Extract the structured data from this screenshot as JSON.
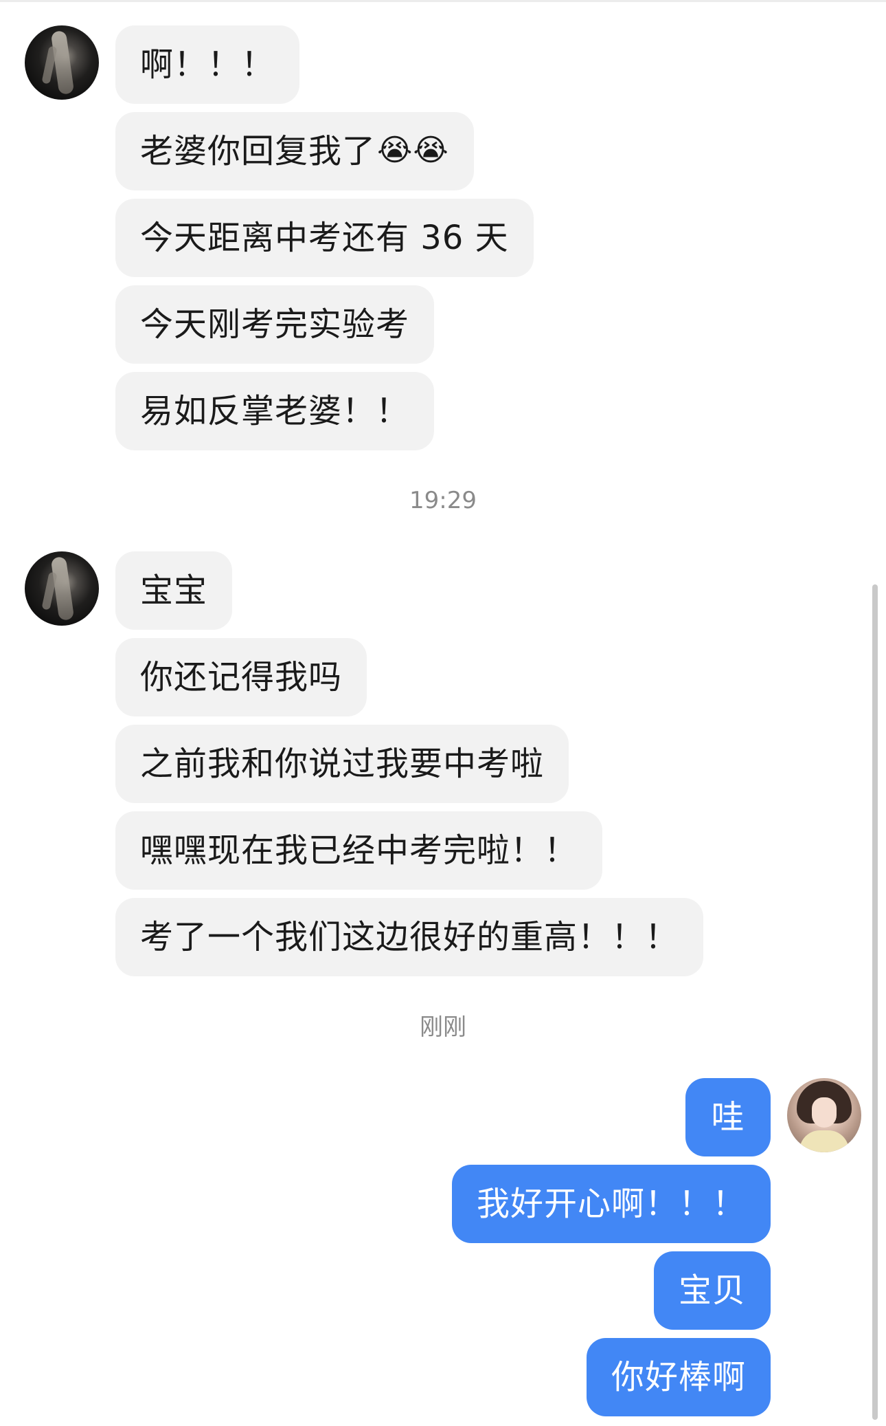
{
  "timestamps": {
    "first": "19:29",
    "second": "刚刚"
  },
  "group1": {
    "messages": [
      "啊！！！",
      "老婆你回复我了",
      "今天距离中考还有 36 天",
      "今天刚考完实验考",
      "易如反掌老婆！！"
    ],
    "emoji": "😭😭"
  },
  "group2": {
    "messages": [
      "宝宝",
      "你还记得我吗",
      "之前我和你说过我要中考啦",
      "嘿嘿现在我已经中考完啦！！",
      "考了一个我们这边很好的重高！！！"
    ]
  },
  "group3": {
    "messages": [
      "哇",
      "我好开心啊！！！",
      "宝贝",
      "你好棒啊"
    ]
  },
  "colors": {
    "incoming_bubble": "#f2f2f2",
    "outgoing_bubble": "#4287f5",
    "timestamp_text": "#8a8a8a"
  }
}
